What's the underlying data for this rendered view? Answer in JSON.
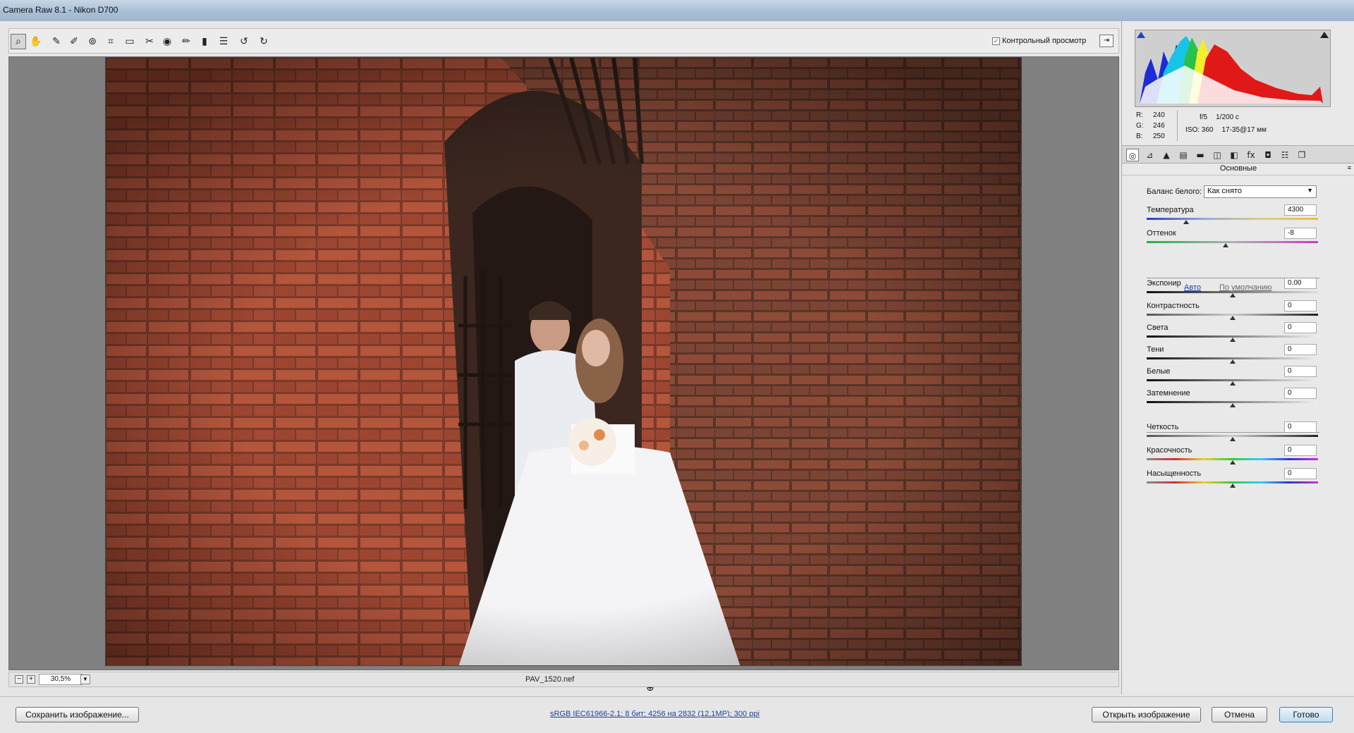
{
  "app": {
    "title": "Camera Raw 8.1  -  Nikon D700"
  },
  "toolbar": {
    "tools": [
      {
        "name": "zoom-tool-icon",
        "glyph": "⌕"
      },
      {
        "name": "hand-tool-icon",
        "glyph": "✋"
      },
      {
        "name": "white-balance-tool-icon",
        "glyph": "✎"
      },
      {
        "name": "color-sampler-tool-icon",
        "glyph": "✐"
      },
      {
        "name": "targeted-adjustment-icon",
        "glyph": "⊚"
      },
      {
        "name": "crop-tool-icon",
        "glyph": "⌗"
      },
      {
        "name": "straighten-tool-icon",
        "glyph": "▭"
      },
      {
        "name": "spot-removal-icon",
        "glyph": "✂"
      },
      {
        "name": "red-eye-icon",
        "glyph": "◉"
      },
      {
        "name": "adjustment-brush-icon",
        "glyph": "✏"
      },
      {
        "name": "graduated-filter-icon",
        "glyph": "▮"
      },
      {
        "name": "preferences-icon",
        "glyph": "☰"
      },
      {
        "name": "rotate-left-icon",
        "glyph": "↺"
      },
      {
        "name": "rotate-right-icon",
        "glyph": "↻"
      }
    ],
    "preview_label": "Контрольный просмотр",
    "preview_checked": "✓",
    "fullscreen_glyph": "⇥"
  },
  "status": {
    "zoom_out": "−",
    "zoom_in": "+",
    "zoom_value": "30,5%",
    "zoom_drop": "▼",
    "filename": "PAV_1520.nef"
  },
  "readout": {
    "r_label": "R:",
    "r": "240",
    "g_label": "G:",
    "g": "246",
    "b_label": "B:",
    "b": "250",
    "aperture": "f/5",
    "shutter": "1/200 с",
    "iso": "ISO: 360",
    "lens": "17-35@17 мм"
  },
  "panel": {
    "tabs": [
      "◎",
      "⊿",
      "▲",
      "▤",
      "▬",
      "◫",
      "◧",
      "fx",
      "◘",
      "☷",
      "❐"
    ],
    "title": "Основные",
    "menu_glyph": "≡",
    "wb_label": "Баланс белого:",
    "wb_value": "Как снято",
    "wb_arrow": "▼",
    "auto": "Авто",
    "default": "По умолчанию",
    "sliders": [
      {
        "label": "Температура",
        "value": "4300",
        "level": 0.23
      },
      {
        "label": "Оттенок",
        "value": "-8",
        "level": 0.46
      },
      {
        "label": "Экспонир",
        "value": "0,00",
        "level": 0.5
      },
      {
        "label": "Контрастность",
        "value": "0",
        "level": 0.5
      },
      {
        "label": "Света",
        "value": "0",
        "level": 0.5
      },
      {
        "label": "Тени",
        "value": "0",
        "level": 0.5
      },
      {
        "label": "Белые",
        "value": "0",
        "level": 0.5
      },
      {
        "label": "Затемнение",
        "value": "0",
        "level": 0.5
      },
      {
        "label": "Четкость",
        "value": "0",
        "level": 0.5
      },
      {
        "label": "Красочность",
        "value": "0",
        "level": 0.5
      },
      {
        "label": "Насыщенность",
        "value": "0",
        "level": 0.5
      }
    ]
  },
  "bottom": {
    "save": "Сохранить изображение...",
    "workflow": "sRGB IEC61966-2.1; 8 бит; 4256 на 2832 (12,1МР); 300 ppi",
    "open": "Открыть изображение",
    "cancel": "Отмена",
    "done": "Готово"
  }
}
